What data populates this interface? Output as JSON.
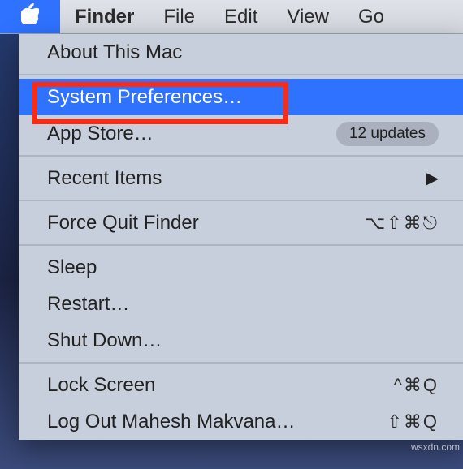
{
  "menubar": {
    "apple_icon": "apple-logo",
    "items": [
      "Finder",
      "File",
      "Edit",
      "View",
      "Go"
    ]
  },
  "menu": {
    "about": "About This Mac",
    "system_preferences": "System Preferences…",
    "app_store": "App Store…",
    "app_store_badge": "12 updates",
    "recent_items": "Recent Items",
    "force_quit": "Force Quit Finder",
    "force_quit_shortcut": "⌥⇧⌘⎋",
    "sleep": "Sleep",
    "restart": "Restart…",
    "shut_down": "Shut Down…",
    "lock_screen": "Lock Screen",
    "lock_screen_shortcut": "^⌘Q",
    "log_out": "Log Out Mahesh Makvana…",
    "log_out_shortcut": "⇧⌘Q"
  },
  "watermark": "wsxdn.com",
  "colors": {
    "highlight": "#2f72ff",
    "annotation": "#ff2a12",
    "menubg": "#c7cedc"
  }
}
